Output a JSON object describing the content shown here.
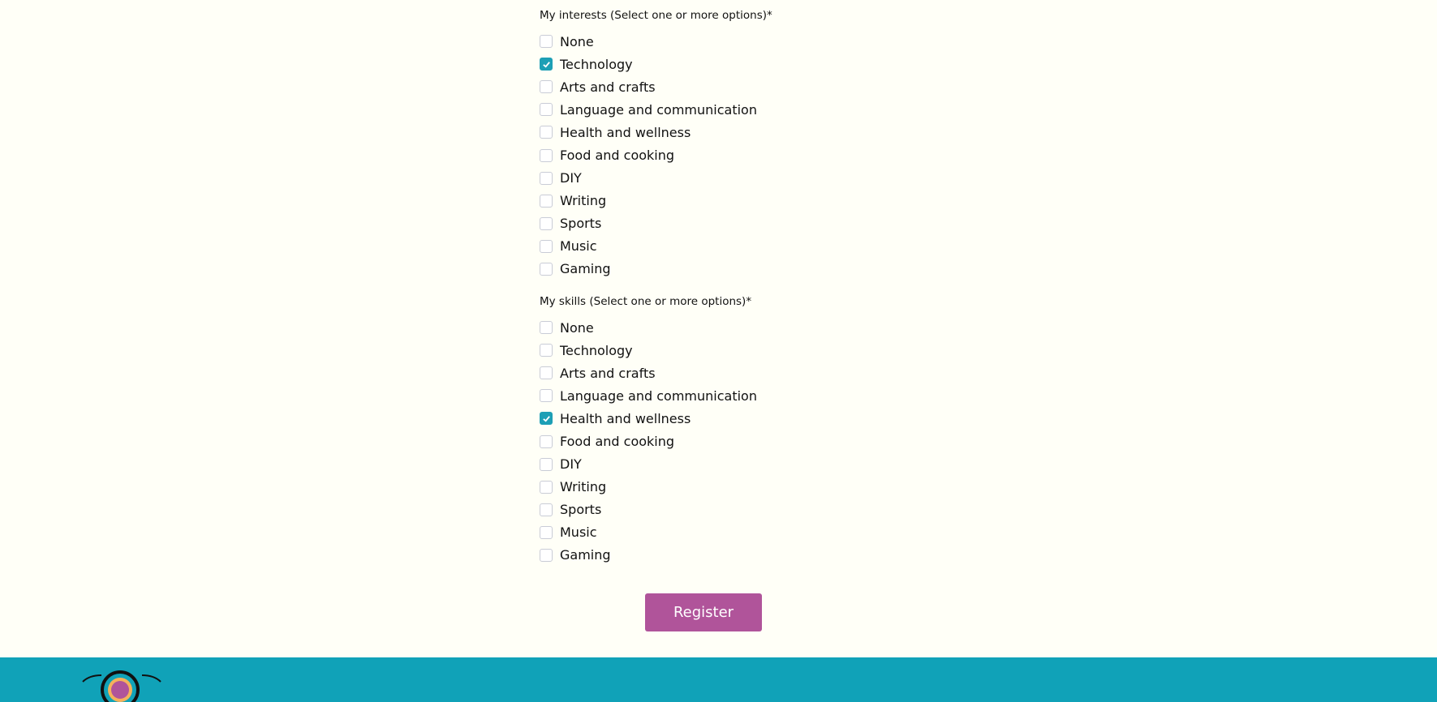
{
  "interests": {
    "label": "My interests (Select one or more options)*",
    "options": [
      {
        "label": "None",
        "checked": false
      },
      {
        "label": "Technology",
        "checked": true
      },
      {
        "label": "Arts and crafts",
        "checked": false
      },
      {
        "label": "Language and communication",
        "checked": false
      },
      {
        "label": "Health and wellness",
        "checked": false
      },
      {
        "label": "Food and cooking",
        "checked": false
      },
      {
        "label": "DIY",
        "checked": false
      },
      {
        "label": "Writing",
        "checked": false
      },
      {
        "label": "Sports",
        "checked": false
      },
      {
        "label": "Music",
        "checked": false
      },
      {
        "label": "Gaming",
        "checked": false
      }
    ]
  },
  "skills": {
    "label": "My skills (Select one or more options)*",
    "options": [
      {
        "label": "None",
        "checked": false
      },
      {
        "label": "Technology",
        "checked": false
      },
      {
        "label": "Arts and crafts",
        "checked": false
      },
      {
        "label": "Language and communication",
        "checked": false
      },
      {
        "label": "Health and wellness",
        "checked": true
      },
      {
        "label": "Food and cooking",
        "checked": false
      },
      {
        "label": "DIY",
        "checked": false
      },
      {
        "label": "Writing",
        "checked": false
      },
      {
        "label": "Sports",
        "checked": false
      },
      {
        "label": "Music",
        "checked": false
      },
      {
        "label": "Gaming",
        "checked": false
      }
    ]
  },
  "register_label": "Register",
  "colors": {
    "accent": "#1d9fb5",
    "button": "#b0549a",
    "footer": "#10a2b8",
    "background": "#fffff7"
  }
}
